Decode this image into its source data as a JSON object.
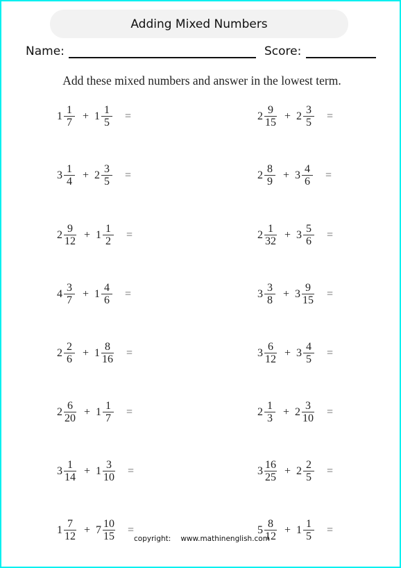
{
  "title": "Adding Mixed Numbers",
  "name_label": "Name:",
  "score_label": "Score:",
  "instructions": "Add these mixed numbers and answer in the lowest term.",
  "problems": [
    {
      "a": {
        "whole": "1",
        "num": "1",
        "den": "7"
      },
      "op": "+",
      "b": {
        "whole": "1",
        "num": "1",
        "den": "5"
      },
      "eq": "="
    },
    {
      "a": {
        "whole": "2",
        "num": "9",
        "den": "15"
      },
      "op": "+",
      "b": {
        "whole": "2",
        "num": "3",
        "den": "5"
      },
      "eq": "="
    },
    {
      "a": {
        "whole": "3",
        "num": "1",
        "den": "4"
      },
      "op": "+",
      "b": {
        "whole": "2",
        "num": "3",
        "den": "5"
      },
      "eq": "="
    },
    {
      "a": {
        "whole": "2",
        "num": "8",
        "den": "9"
      },
      "op": "+",
      "b": {
        "whole": "3",
        "num": "4",
        "den": "6"
      },
      "eq": "="
    },
    {
      "a": {
        "whole": "2",
        "num": "9",
        "den": "12"
      },
      "op": "+",
      "b": {
        "whole": "1",
        "num": "1",
        "den": "2"
      },
      "eq": "="
    },
    {
      "a": {
        "whole": "2",
        "num": "1",
        "den": "32"
      },
      "op": "+",
      "b": {
        "whole": "3",
        "num": "5",
        "den": "6"
      },
      "eq": "="
    },
    {
      "a": {
        "whole": "4",
        "num": "3",
        "den": "7"
      },
      "op": "+",
      "b": {
        "whole": "1",
        "num": "4",
        "den": "6"
      },
      "eq": "="
    },
    {
      "a": {
        "whole": "3",
        "num": "3",
        "den": "8"
      },
      "op": "+",
      "b": {
        "whole": "3",
        "num": "9",
        "den": "15"
      },
      "eq": "="
    },
    {
      "a": {
        "whole": "2",
        "num": "2",
        "den": "6"
      },
      "op": "+",
      "b": {
        "whole": "1",
        "num": "8",
        "den": "16"
      },
      "eq": "="
    },
    {
      "a": {
        "whole": "3",
        "num": "6",
        "den": "12"
      },
      "op": "+",
      "b": {
        "whole": "3",
        "num": "4",
        "den": "5"
      },
      "eq": "="
    },
    {
      "a": {
        "whole": "2",
        "num": "6",
        "den": "20"
      },
      "op": "+",
      "b": {
        "whole": "1",
        "num": "1",
        "den": "7"
      },
      "eq": "="
    },
    {
      "a": {
        "whole": "2",
        "num": "1",
        "den": "3"
      },
      "op": "+",
      "b": {
        "whole": "2",
        "num": "3",
        "den": "10"
      },
      "eq": "="
    },
    {
      "a": {
        "whole": "3",
        "num": "1",
        "den": "14"
      },
      "op": "+",
      "b": {
        "whole": "1",
        "num": "3",
        "den": "10"
      },
      "eq": "="
    },
    {
      "a": {
        "whole": "3",
        "num": "16",
        "den": "25"
      },
      "op": "+",
      "b": {
        "whole": "2",
        "num": "2",
        "den": "5"
      },
      "eq": "="
    },
    {
      "a": {
        "whole": "1",
        "num": "7",
        "den": "12"
      },
      "op": "+",
      "b": {
        "whole": "7",
        "num": "10",
        "den": "15"
      },
      "eq": "="
    },
    {
      "a": {
        "whole": "5",
        "num": "8",
        "den": "12"
      },
      "op": "+",
      "b": {
        "whole": "1",
        "num": "1",
        "den": "5"
      },
      "eq": "="
    }
  ],
  "footer": {
    "copyright_label": "copyright:",
    "website": "www.mathinenglish.com"
  }
}
